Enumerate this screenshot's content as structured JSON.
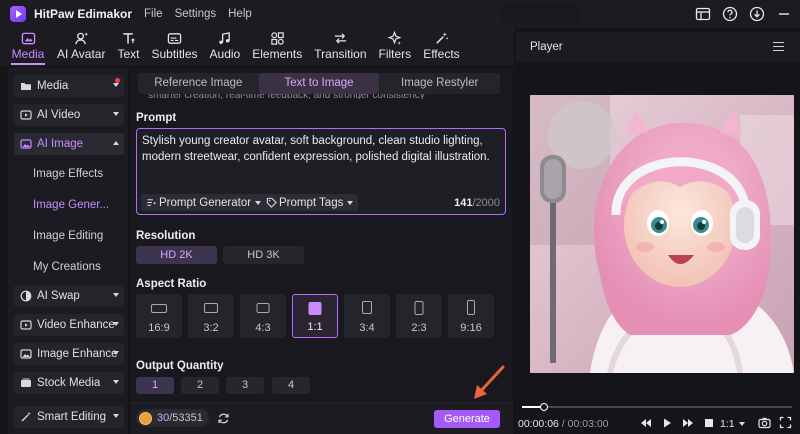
{
  "app": {
    "title": "HitPaw Edimakor",
    "menu": [
      "File",
      "Settings",
      "Help"
    ]
  },
  "toolbar": [
    {
      "label": "Media",
      "icon": "media-icon",
      "active": true
    },
    {
      "label": "AI Avatar",
      "icon": "avatar-icon"
    },
    {
      "label": "Text",
      "icon": "text-icon"
    },
    {
      "label": "Subtitles",
      "icon": "subtitles-icon"
    },
    {
      "label": "Audio",
      "icon": "music-icon"
    },
    {
      "label": "Elements",
      "icon": "elements-icon"
    },
    {
      "label": "Transition",
      "icon": "transition-icon"
    },
    {
      "label": "Filters",
      "icon": "filters-icon"
    },
    {
      "label": "Effects",
      "icon": "effects-icon"
    }
  ],
  "sidebar": {
    "items": [
      {
        "label": "Media",
        "icon": "folder-icon"
      },
      {
        "label": "AI Video",
        "icon": "ai-video-icon"
      },
      {
        "label": "AI Image",
        "icon": "ai-image-icon"
      },
      {
        "label": "AI Swap",
        "icon": "ai-swap-icon"
      },
      {
        "label": "Video Enhance",
        "icon": "video-enhance-icon"
      },
      {
        "label": "Image Enhance",
        "icon": "image-enhance-icon"
      },
      {
        "label": "Stock Media",
        "icon": "stock-media-icon"
      },
      {
        "label": "Smart Editing",
        "icon": "smart-editing-icon"
      }
    ],
    "sub_items": [
      "Image Effects",
      "Image Gener...",
      "Image Editing",
      "My Creations"
    ]
  },
  "center": {
    "tabs": [
      "Reference Image",
      "Text to Image",
      "Image Restyler"
    ],
    "active_tab": 1,
    "cut_text": "smarter creation, real-time feedback, and stronger consistency",
    "prompt_label": "Prompt",
    "prompt_text": "Stylish young creator avatar, soft background, clean studio lighting, modern streetwear, confident expression, polished digital illustration.",
    "prompt_generator": "Prompt Generator",
    "prompt_tags": "Prompt Tags",
    "char_count": "141",
    "char_max": "/2000",
    "resolution_label": "Resolution",
    "resolutions": [
      "HD 2K",
      "HD 3K"
    ],
    "aspect_label": "Aspect Ratio",
    "aspects": [
      "16:9",
      "3:2",
      "4:3",
      "1:1",
      "3:4",
      "2:3",
      "9:16"
    ],
    "quantity_label": "Output Quantity",
    "quantities": [
      "1",
      "2",
      "3",
      "4"
    ],
    "credits_used": "30",
    "credits_total": "/53351",
    "generate": "Generate"
  },
  "player": {
    "title": "Player",
    "time_current": "00:00:06",
    "time_total": " / 00:03:00",
    "ratio": "1:1",
    "progress": 0.08
  },
  "colors": {
    "accent": "#c98cff",
    "generate": "#a45af6",
    "arrow": "#e8643c"
  }
}
